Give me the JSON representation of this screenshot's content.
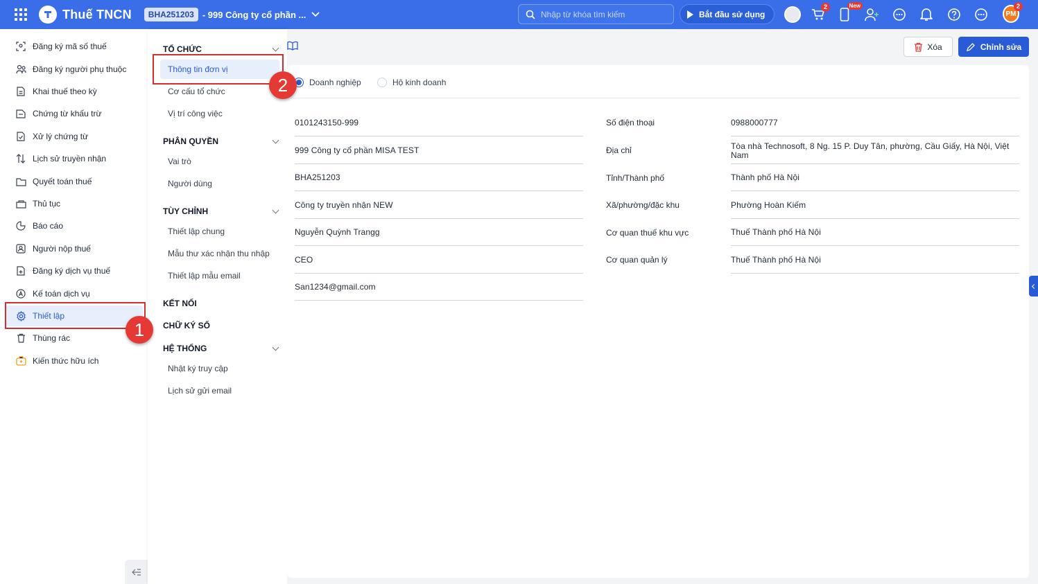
{
  "header": {
    "app_title": "Thuế TNCN",
    "org_code": "BHA251203",
    "org_name": "- 999 Công ty cổ phần ...",
    "search_placeholder": "Nhập từ khóa tìm kiếm",
    "start_label": "Bắt đầu sử dụng",
    "cart_badge": "2",
    "new_badge": "New",
    "user_initials": "PM",
    "user_badge": "2"
  },
  "sidebar": {
    "items": [
      {
        "label": "Đăng ký mã số thuế",
        "icon": "scan-icon"
      },
      {
        "label": "Đăng ký người phụ thuộc",
        "icon": "people-icon"
      },
      {
        "label": "Khai thuế theo kỳ",
        "icon": "document-icon"
      },
      {
        "label": "Chứng từ khấu trừ",
        "icon": "voucher-icon"
      },
      {
        "label": "Xử lý chứng từ",
        "icon": "process-icon"
      },
      {
        "label": "Lịch sử truyền nhận",
        "icon": "transfer-icon"
      },
      {
        "label": "Quyết toán thuế",
        "icon": "folder-icon"
      },
      {
        "label": "Thủ tục",
        "icon": "procedure-icon"
      },
      {
        "label": "Báo cáo",
        "icon": "report-icon"
      },
      {
        "label": "Người nộp thuế",
        "icon": "taxpayer-icon"
      },
      {
        "label": "Đăng ký dịch vụ thuế",
        "icon": "service-icon"
      },
      {
        "label": "Kế toán dịch vụ",
        "icon": "accounting-icon"
      },
      {
        "label": "Thiết lập",
        "icon": "gear-icon"
      },
      {
        "label": "Thùng rác",
        "icon": "trash-icon"
      },
      {
        "label": "Kiến thức hữu ích",
        "icon": "knowledge-icon"
      }
    ]
  },
  "submenu": {
    "sections": [
      {
        "title": "TỔ CHỨC",
        "items": [
          "Thông tin đơn vị",
          "Cơ cấu tổ chức",
          "Vị trí công việc"
        ]
      },
      {
        "title": "PHÂN QUYỀN",
        "items": [
          "Vai trò",
          "Người dùng"
        ]
      },
      {
        "title": "TÙY CHỈNH",
        "items": [
          "Thiết lập chung",
          "Mẫu thư xác nhận thu nhập",
          "Thiết lập mẫu email"
        ]
      },
      {
        "title": "KẾT NỐI",
        "items": []
      },
      {
        "title": "CHỮ KÝ SỐ",
        "items": []
      },
      {
        "title": "HỆ THỐNG",
        "items": [
          "Nhật ký truy cập",
          "Lịch sử gửi email"
        ]
      }
    ]
  },
  "toolbar": {
    "delete_label": "Xóa",
    "edit_label": "Chỉnh sửa"
  },
  "form": {
    "type_options": [
      "Doanh nghiệp",
      "Hộ kinh doanh"
    ],
    "selected_type": "Doanh nghiệp",
    "left_values": [
      "0101243150-999",
      "999 Công ty cổ phần MISA TEST",
      "BHA251203",
      "Công ty truyền nhận NEW",
      "Nguyễn Quỳnh Trangg",
      "CEO",
      "San1234@gmail.com"
    ],
    "right_fields": [
      {
        "label": "Số điện thoại",
        "value": "0988000777"
      },
      {
        "label": "Địa chỉ",
        "value": "Tòa nhà Technosoft, 8 Ng. 15 P. Duy Tân, phường, Cầu Giấy, Hà Nội, Việt Nam"
      },
      {
        "label": "Tỉnh/Thành phố",
        "value": "Thành phố Hà Nội"
      },
      {
        "label": "Xã/phường/đặc khu",
        "value": "Phường Hoàn Kiếm"
      },
      {
        "label": "Cơ quan thuế khu vực",
        "value": "Thuế Thành phố Hà Nội"
      },
      {
        "label": "Cơ quan quản lý",
        "value": "Thuế Thành phố Hà Nội"
      }
    ]
  },
  "annotations": {
    "marker_1": "1",
    "marker_2": "2"
  },
  "colors": {
    "brand": "#3a6ee8",
    "primary": "#2a5bd7",
    "highlight": "#d32f2f"
  }
}
